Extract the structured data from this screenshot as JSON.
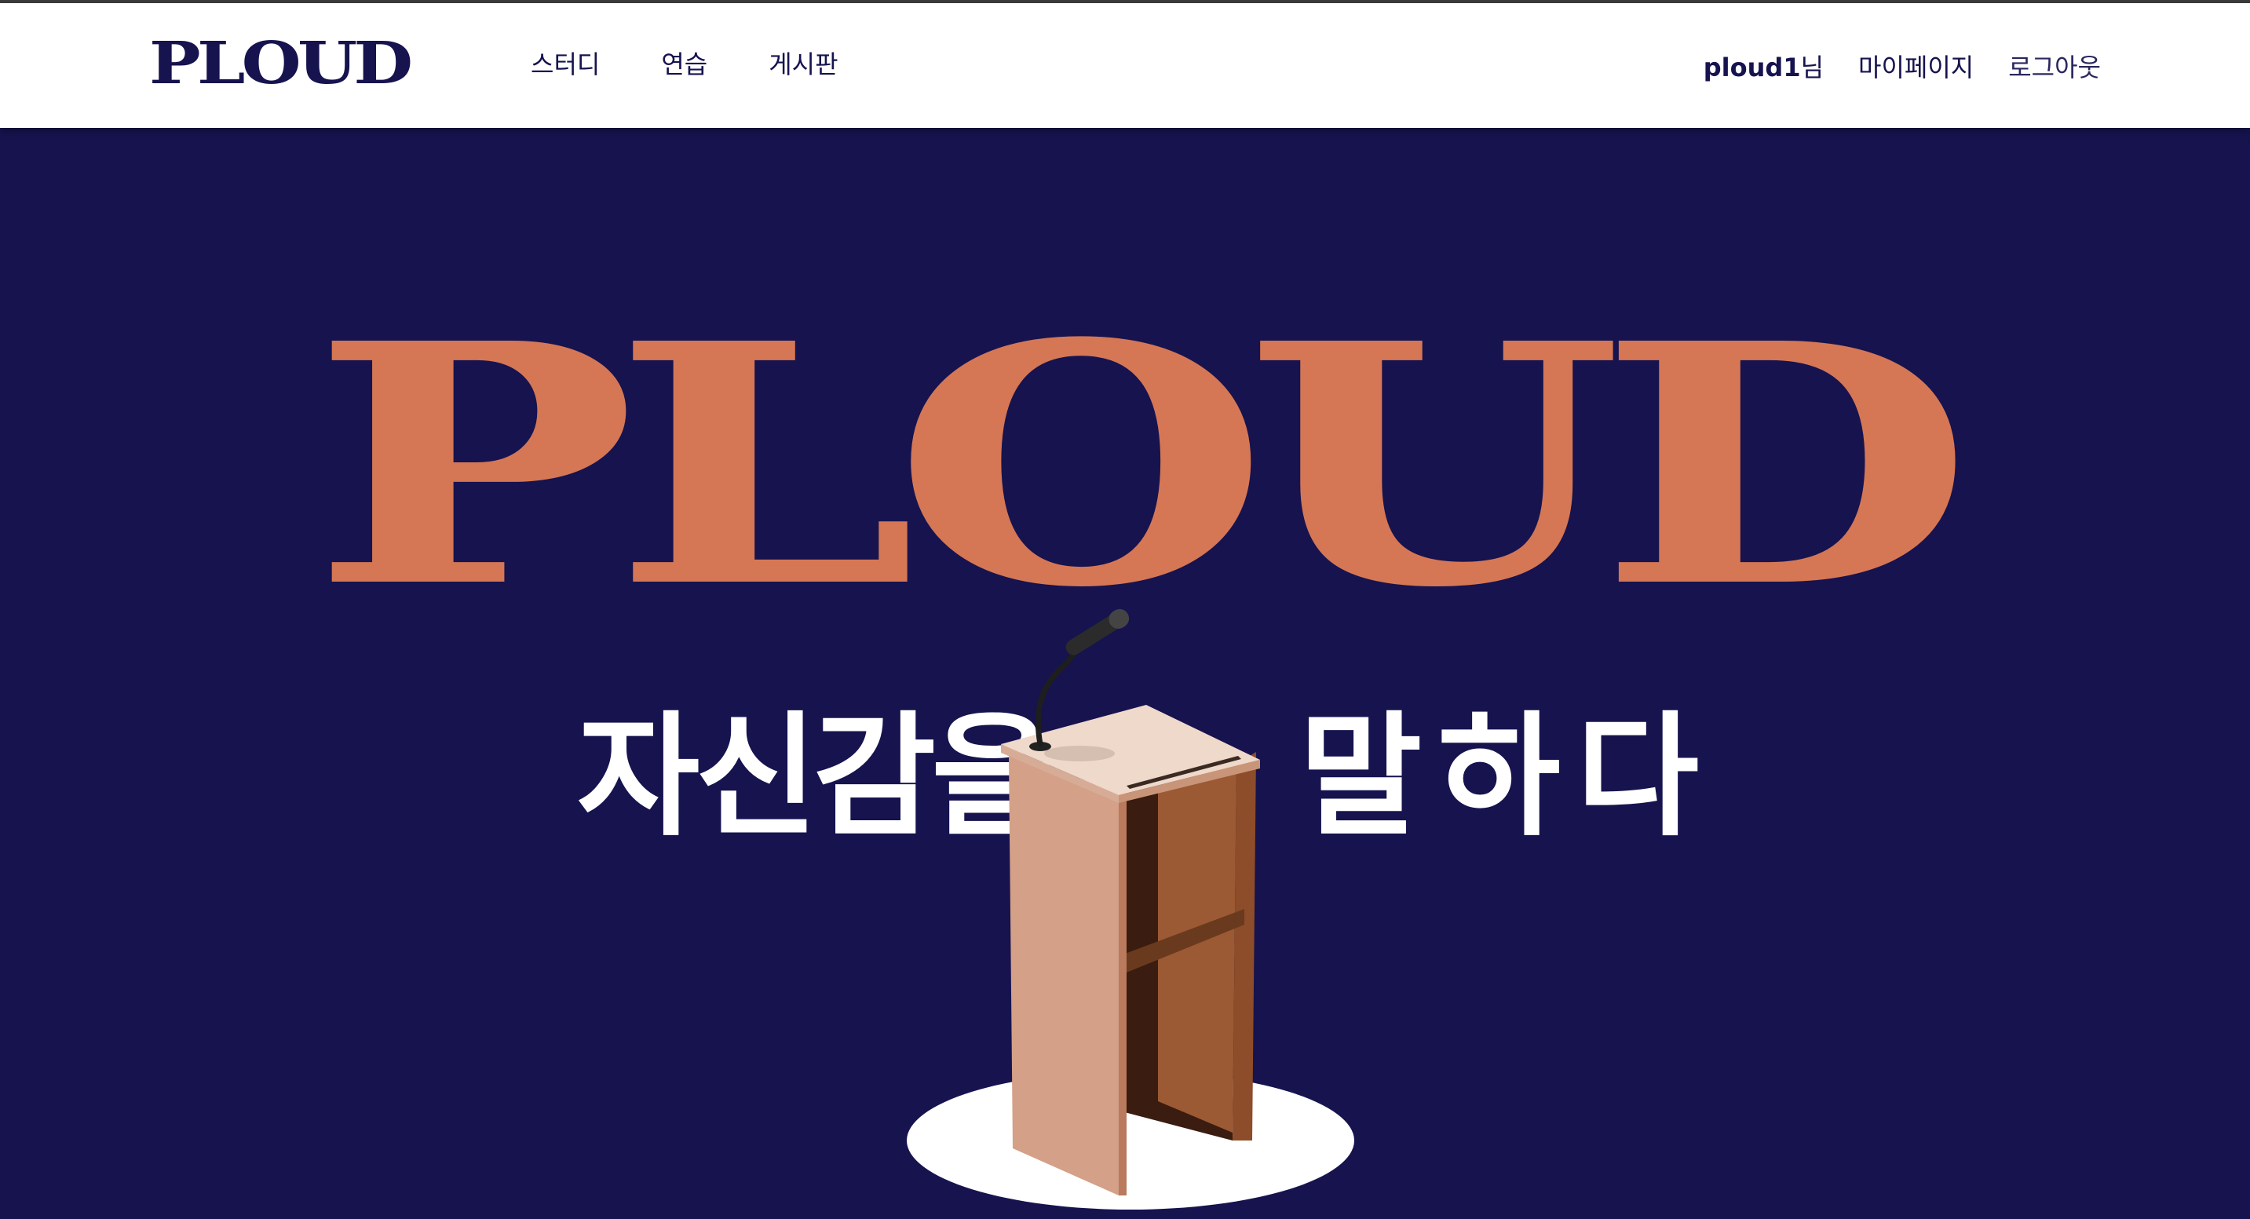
{
  "header": {
    "logo": "PLOUD",
    "nav": [
      {
        "label": "스터디"
      },
      {
        "label": "연습"
      },
      {
        "label": "게시판"
      }
    ],
    "user": {
      "name": "ploud1",
      "suffix": "님"
    },
    "mypage_label": "마이페이지",
    "logout_label": "로그아웃"
  },
  "hero": {
    "title": "PLOUD",
    "tagline_left": "자신감을",
    "tagline_right": "말하다"
  },
  "colors": {
    "navy": "#16134f",
    "accent": "#d57755",
    "white": "#ffffff"
  },
  "icons": {
    "podium": "podium-with-microphone-illustration"
  }
}
